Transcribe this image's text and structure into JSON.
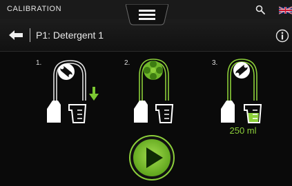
{
  "statusbar": {
    "title": "CALIBRATION",
    "icons": [
      "menu-icon",
      "search-icon",
      "uk-flag-icon"
    ]
  },
  "header": {
    "back_icon": "back-arrow-icon",
    "title": "P1: Detergent 1",
    "info_icon": "info-icon"
  },
  "steps": [
    {
      "number": "1.",
      "tube": "white",
      "icons": [
        "pump-head-icon",
        "bottle-icon",
        "measuring-cup-icon",
        "down-arrow-icon"
      ]
    },
    {
      "number": "2.",
      "tube": "green",
      "icons": [
        "rotating-pump-head-icon",
        "bottle-icon",
        "measuring-cup-icon"
      ]
    },
    {
      "number": "3.",
      "tube": "green",
      "icons": [
        "pump-head-icon",
        "bottle-icon",
        "measuring-cup-filled-icon"
      ]
    }
  ],
  "result": {
    "volume": "250 ml"
  },
  "actions": {
    "play_icon": "play-icon"
  },
  "colors": {
    "accent_green": "#8ccf3a",
    "dark_green": "#5ea41c",
    "background": "#0a0a0a",
    "topbar": "#1a1a1a"
  }
}
